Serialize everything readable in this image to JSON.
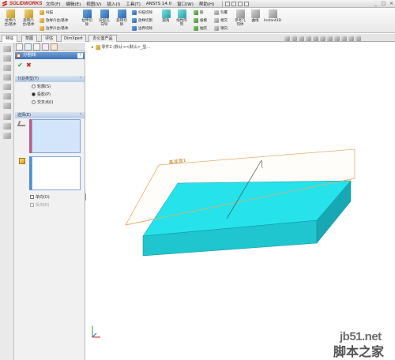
{
  "app": {
    "logo_text": "SOLIDWORKS",
    "menus": [
      "文件(F)",
      "编辑(E)",
      "视图(V)",
      "插入(I)",
      "工具(T)",
      "ANSYS 14.0",
      "窗口(W)",
      "帮助(H)"
    ],
    "window_buttons": [
      "_",
      "□",
      "×"
    ]
  },
  "ribbon": {
    "large_buttons": [
      {
        "label": "拉伸凸\n台/基体",
        "icon": "extrude-boss-icon"
      },
      {
        "label": "旋转凸\n台/基体",
        "icon": "revolve-boss-icon"
      },
      {
        "label": "拉伸切\n除",
        "icon": "extrude-cut-icon"
      },
      {
        "label": "异型孔\n向导",
        "icon": "hole-wizard-icon"
      },
      {
        "label": "旋转切\n除",
        "icon": "revolve-cut-icon"
      },
      {
        "label": "圆角",
        "icon": "fillet-icon"
      },
      {
        "label": "线性阵\n列",
        "icon": "linear-pattern-icon"
      },
      {
        "label": "参考几\n何体",
        "icon": "reference-geometry-icon"
      },
      {
        "label": "曲线",
        "icon": "curves-icon"
      },
      {
        "label": "Instant3D",
        "icon": "instant3d-icon"
      }
    ],
    "small_buttons": [
      {
        "label": "扫描",
        "icon": "sweep-icon"
      },
      {
        "label": "放样凸台/基体",
        "icon": "loft-boss-icon"
      },
      {
        "label": "边界凸台/基体",
        "icon": "boundary-boss-icon"
      },
      {
        "label": "扫描切除",
        "icon": "swept-cut-icon"
      },
      {
        "label": "放样切割",
        "icon": "lofted-cut-icon"
      },
      {
        "label": "边界切除",
        "icon": "boundary-cut-icon"
      },
      {
        "label": "筋",
        "icon": "rib-icon"
      },
      {
        "label": "拔模",
        "icon": "draft-icon"
      },
      {
        "label": "抽壳",
        "icon": "shell-icon"
      },
      {
        "label": "包覆",
        "icon": "wrap-icon"
      },
      {
        "label": "相交",
        "icon": "intersect-icon"
      },
      {
        "label": "镜向",
        "icon": "mirror-icon"
      }
    ]
  },
  "tabs": [
    "特征",
    "草图",
    "评估",
    "DimXpert",
    "办公室产品"
  ],
  "property_manager": {
    "title": "分割线",
    "help": "?",
    "ok_symbol": "✔",
    "cancel_symbol": "✖",
    "split_type": {
      "header": "分割类型(T)",
      "options": [
        {
          "label": "轮廓(S)",
          "selected": false
        },
        {
          "label": "投影(P)",
          "selected": true
        },
        {
          "label": "交叉点(I)",
          "selected": false
        }
      ]
    },
    "selections": {
      "header": "选择(E)",
      "single_direction": "单向(D)",
      "reverse_direction": "反向(R)"
    },
    "collapse_symbol": "⌃"
  },
  "viewport": {
    "tree_label": "零件2 (默认<<默认>_显...",
    "plane_label": "基准面1",
    "colors": {
      "plane_stroke": "#e2ae6a",
      "block_top": "#26e3eb",
      "block_front": "#1fc5cf",
      "block_side": "#17a8b4",
      "accent": "#3f73b8"
    }
  },
  "watermark": {
    "site": "jb51.net",
    "cn": "脚本之家"
  }
}
